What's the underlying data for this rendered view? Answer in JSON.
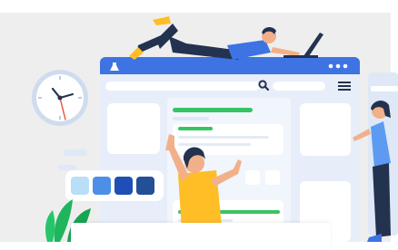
{
  "illustration": {
    "description_free": true,
    "colors": {
      "background": "#eeeeef",
      "browser_header": "#3e73e3",
      "browser_body": "#e7eef9",
      "panel": "#ffffff",
      "accent_green": "#37c464",
      "dark_navy": "#23324f",
      "skin": "#f2b08a",
      "yellow_shirt": "#ffbd26",
      "swatch_light": "#b9def7",
      "swatch_mid": "#4d8fe8",
      "swatch_dark": "#1f4fb6",
      "swatch_navy": "#234f97",
      "plant": "#1fb55c",
      "clock_face": "#ffffff",
      "clock_rim": "#cfdcef",
      "woman_top": "#5c9bf1"
    },
    "icons": [
      "clock-icon",
      "search-icon",
      "hamburger-menu-icon",
      "bell-icon",
      "laptop-icon",
      "window-dots-icon",
      "plant-icon"
    ]
  },
  "caption": {
    "text": ""
  }
}
